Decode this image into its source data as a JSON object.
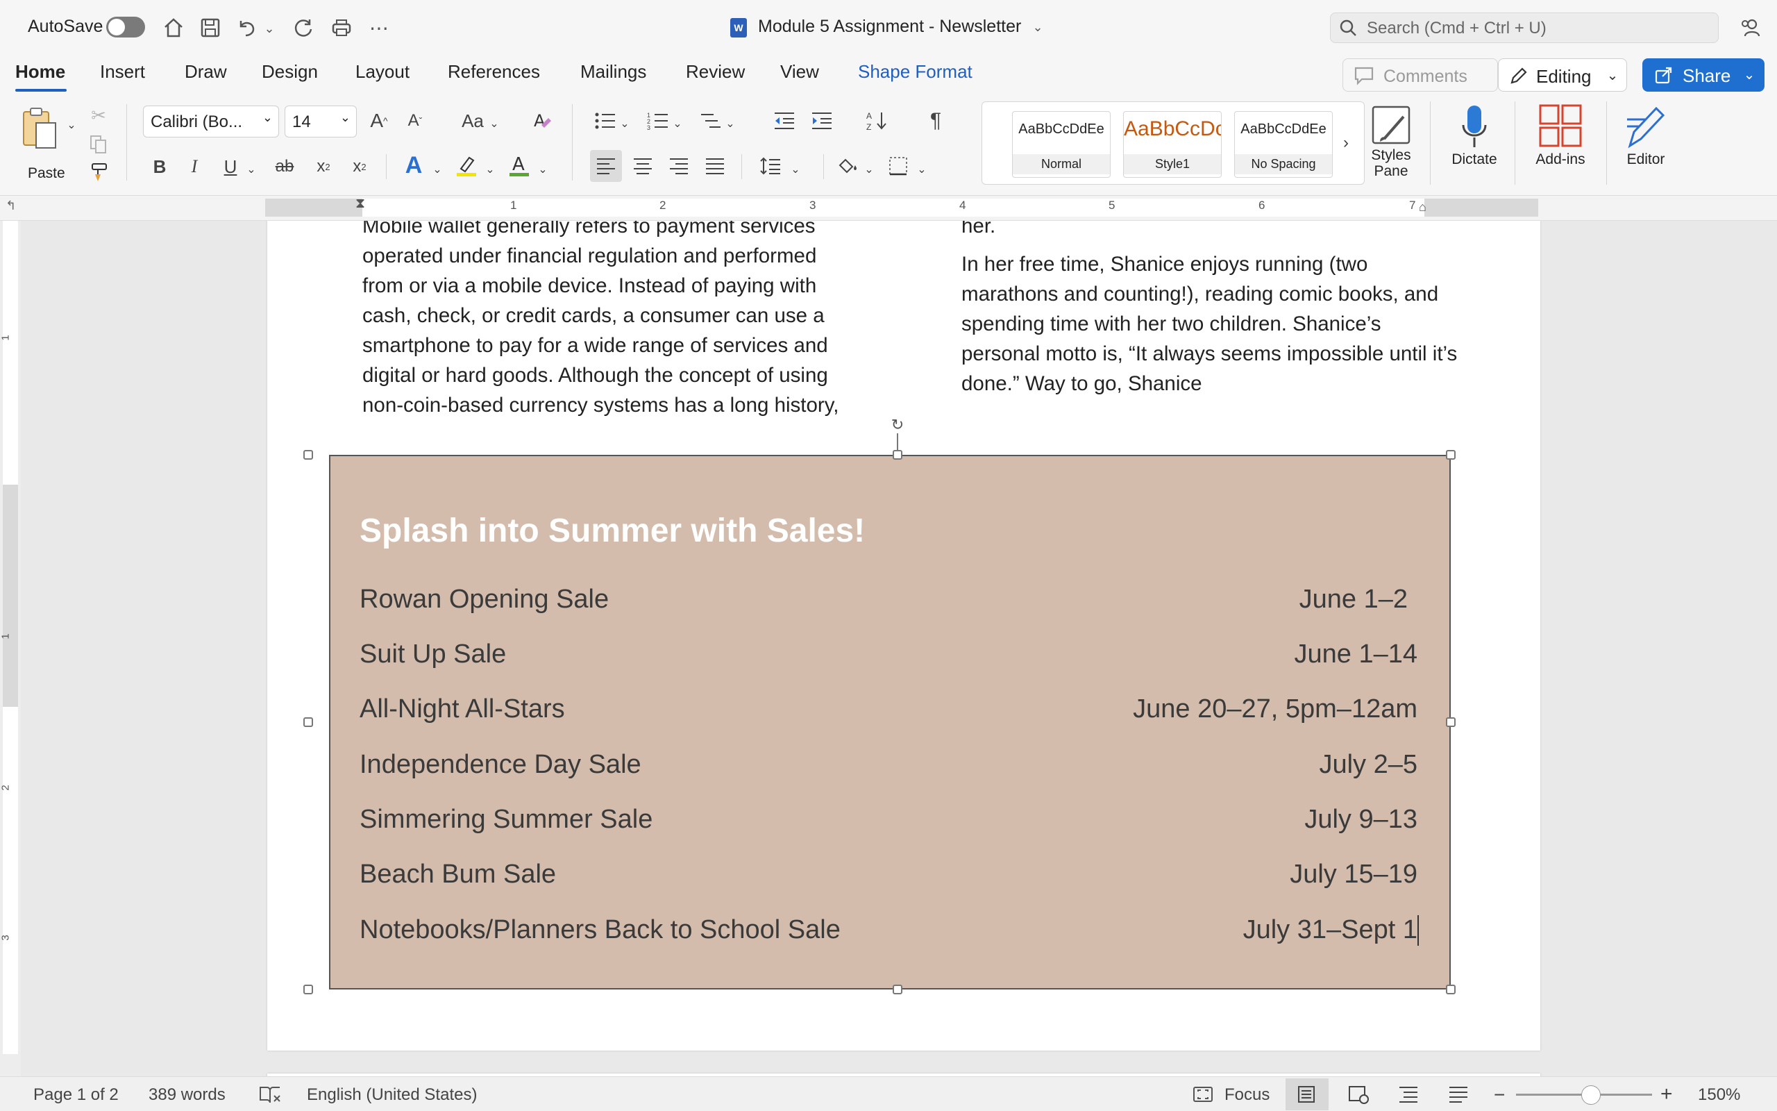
{
  "titlebar": {
    "autosave_label": "AutoSave",
    "doc_title": "Module 5 Assignment - Newsletter",
    "search_placeholder": "Search (Cmd + Ctrl + U)"
  },
  "tabs": [
    "Home",
    "Insert",
    "Draw",
    "Design",
    "Layout",
    "References",
    "Mailings",
    "Review",
    "View",
    "Shape Format"
  ],
  "actions": {
    "comments": "Comments",
    "editing": "Editing",
    "share": "Share"
  },
  "ribbon": {
    "paste_label": "Paste",
    "font_name": "Calibri (Bo...",
    "font_size": "14",
    "styles": [
      {
        "preview": "AaBbCcDdEe",
        "name": "Normal"
      },
      {
        "preview": "AaBbCcDc",
        "name": "Style1"
      },
      {
        "preview": "AaBbCcDdEe",
        "name": "No Spacing"
      }
    ],
    "styles_pane_label": "Styles\nPane",
    "dictate_label": "Dictate",
    "addins_label": "Add-ins",
    "editor_label": "Editor"
  },
  "ruler": {
    "h_ticks": [
      "1",
      "2",
      "3",
      "4",
      "5",
      "6",
      "7"
    ],
    "v_ticks": [
      "1",
      "1",
      "2",
      "3"
    ]
  },
  "document": {
    "left_column_lines": [
      "Mobile wallet generally refers to payment services",
      "operated under financial regulation and performed",
      "from or via a mobile device. Instead of paying with",
      "cash, check, or credit cards, a consumer can use a",
      "smartphone to pay for a wide range of services and",
      "digital or hard goods. Although the concept of using",
      "non-coin-based currency systems has a long history,"
    ],
    "right_column_top": "her.",
    "right_column_lines": [
      "In her free time, Shanice enjoys running (two",
      "marathons and counting!), reading comic books, and",
      "spending time with her two children. Shanice’s",
      "personal motto is, “It always seems impossible until it’s",
      "done.” Way to go, Shanice"
    ],
    "shape": {
      "title": "Splash into Summer with Sales!",
      "fill": "#d3bcac",
      "rows": [
        {
          "name": "Rowan Opening Sale",
          "date": "June 1–2"
        },
        {
          "name": "Suit Up Sale",
          "date": "June 1–14"
        },
        {
          "name": "All-Night All-Stars",
          "date": "June 20–27, 5pm–12am"
        },
        {
          "name": "Independence Day Sale",
          "date": "July 2–5"
        },
        {
          "name": "Simmering Summer Sale",
          "date": "July 9–13"
        },
        {
          "name": "Beach Bum Sale",
          "date": "July 15–19"
        },
        {
          "name": "Notebooks/Planners Back to School Sale",
          "date": "July 31–Sept 1"
        }
      ]
    }
  },
  "status": {
    "page": "Page 1 of 2",
    "words": "389 words",
    "language": "English (United States)",
    "focus": "Focus",
    "zoom": "150%"
  },
  "colors": {
    "accent": "#1f5fbf",
    "share_bg": "#1f6fd1"
  }
}
